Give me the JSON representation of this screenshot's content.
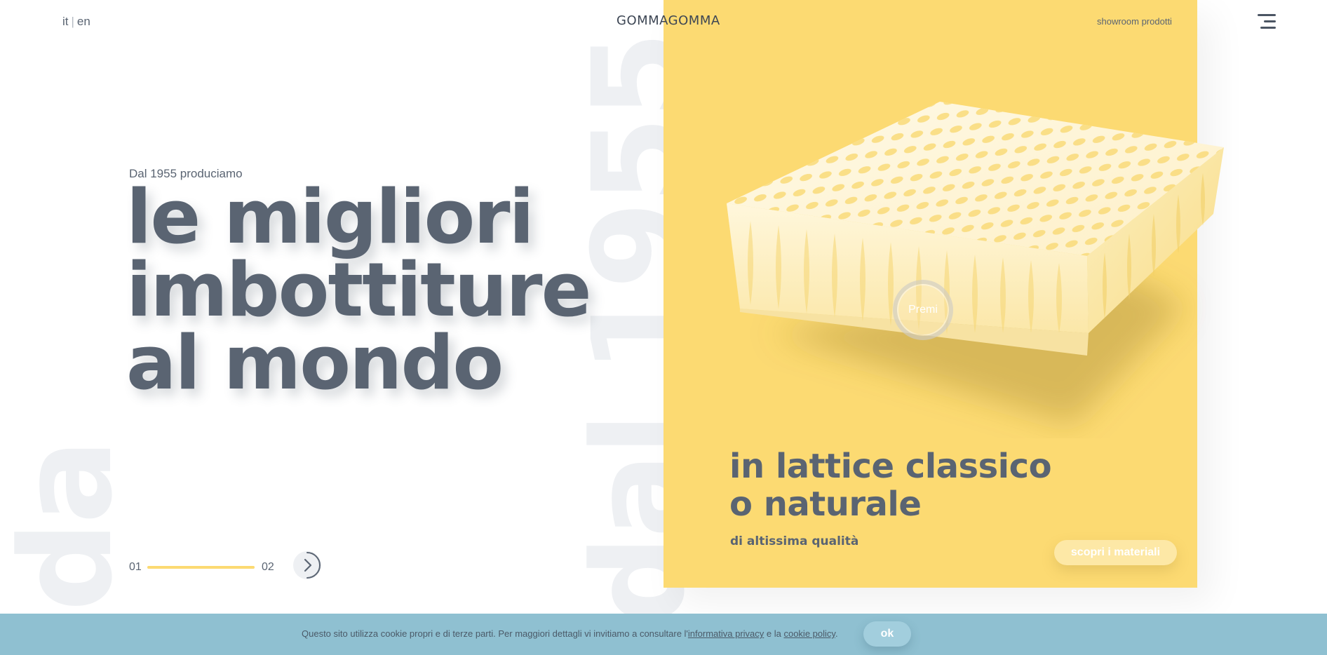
{
  "header": {
    "lang_it": "it",
    "lang_sep": "|",
    "lang_en": "en",
    "logo_text": "GOMMAGOMMA",
    "nav_showroom": "showroom prodotti",
    "menu_icon": "hamburger-menu-icon"
  },
  "background": {
    "word_left": "da",
    "word_center": "dal 1955"
  },
  "hero": {
    "kicker": "Dal 1955 produciamo",
    "headline_lines": [
      "le migliori",
      "imbottiture",
      "al mondo"
    ]
  },
  "slider": {
    "current": "01",
    "next": "02",
    "progress": 1.0,
    "next_icon": "chevron-right-icon"
  },
  "panel": {
    "premi_label": "Premi",
    "title_lines": [
      "in lattice classico",
      "o naturale"
    ],
    "subtitle": "di altissima qualità",
    "cta_label": "scopri i materiali"
  },
  "cookie": {
    "text_before": "Questo sito utilizza cookie propri e di terze parti. Per maggiori dettagli vi invitiamo a consultare l'",
    "privacy_link": "informativa privacy",
    "text_middle": " e la ",
    "cookie_link": "cookie policy",
    "text_after": ".",
    "ok_label": "ok"
  },
  "colors": {
    "accent_yellow": "#fcda72",
    "text_slate": "#5a6472",
    "cookie_blue": "#8fc0d1",
    "bg_word_gray": "#eef0f3"
  }
}
